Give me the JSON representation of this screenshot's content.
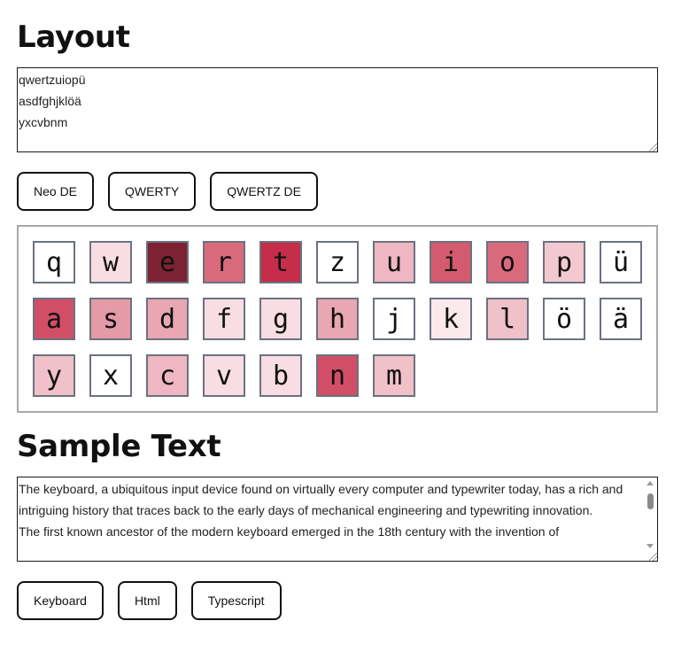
{
  "layout_section": {
    "heading": "Layout",
    "textarea_value": "qwertzuiopü\nasdfghjklöä\nyxcvbnm",
    "buttons": [
      "Neo DE",
      "QWERTY",
      "QWERTZ DE"
    ]
  },
  "keyboard": {
    "rows": [
      [
        {
          "char": "q",
          "color": "#ffffff"
        },
        {
          "char": "w",
          "color": "#f8dde2"
        },
        {
          "char": "e",
          "color": "#7d2232"
        },
        {
          "char": "r",
          "color": "#d96a7b"
        },
        {
          "char": "t",
          "color": "#c52d4a"
        },
        {
          "char": "z",
          "color": "#ffffff"
        },
        {
          "char": "u",
          "color": "#eeb7c1"
        },
        {
          "char": "i",
          "color": "#d45a6f"
        },
        {
          "char": "o",
          "color": "#d96a7b"
        },
        {
          "char": "p",
          "color": "#f3c9d0"
        },
        {
          "char": "ü",
          "color": "#ffffff"
        }
      ],
      [
        {
          "char": "a",
          "color": "#d24e66"
        },
        {
          "char": "s",
          "color": "#e59aa7"
        },
        {
          "char": "d",
          "color": "#e8a7b2"
        },
        {
          "char": "f",
          "color": "#f8dde2"
        },
        {
          "char": "g",
          "color": "#f8dde2"
        },
        {
          "char": "h",
          "color": "#e8a7b2"
        },
        {
          "char": "j",
          "color": "#ffffff"
        },
        {
          "char": "k",
          "color": "#fbe9ec"
        },
        {
          "char": "l",
          "color": "#f0c1c9"
        },
        {
          "char": "ö",
          "color": "#ffffff"
        },
        {
          "char": "ä",
          "color": "#ffffff"
        }
      ],
      [
        {
          "char": "y",
          "color": "#f0c1c9"
        },
        {
          "char": "x",
          "color": "#ffffff"
        },
        {
          "char": "c",
          "color": "#eeb7c1"
        },
        {
          "char": "v",
          "color": "#f8dde2"
        },
        {
          "char": "b",
          "color": "#f8dde2"
        },
        {
          "char": "n",
          "color": "#d24e66"
        },
        {
          "char": "m",
          "color": "#f0c1c9"
        }
      ]
    ]
  },
  "sample_section": {
    "heading": "Sample Text",
    "textarea_value": "The keyboard, a ubiquitous input device found on virtually every computer and typewriter today, has a rich and intriguing history that traces back to the early days of mechanical engineering and typewriting innovation.\nThe first known ancestor of the modern keyboard emerged in the 18th century with the invention of",
    "buttons": [
      "Keyboard",
      "Html",
      "Typescript"
    ]
  },
  "colors": {
    "key_border": "#6b7280",
    "keyboard_border": "#a8a9ae",
    "button_border": "#111111"
  }
}
